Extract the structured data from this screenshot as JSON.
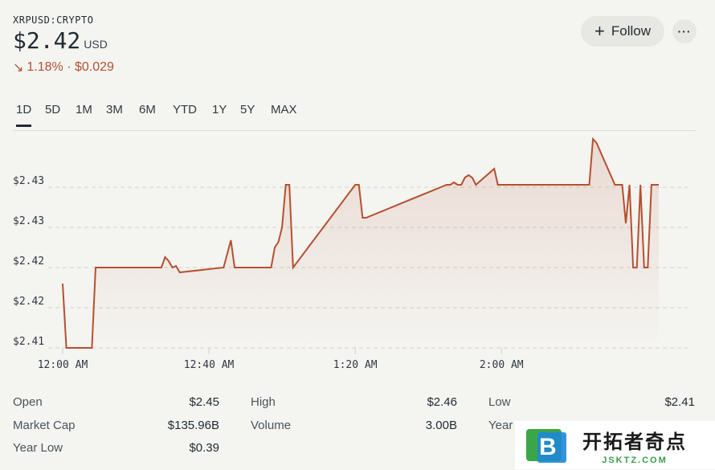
{
  "header": {
    "ticker": "XRPUSD:CRYPTO",
    "price": "$2.42",
    "currency": "USD",
    "change": "1.18% · $0.029",
    "change_color": "#b5502f"
  },
  "actions": {
    "follow_label": "Follow",
    "more_label": "···"
  },
  "tabs": [
    {
      "label": "1D",
      "active": true
    },
    {
      "label": "5D"
    },
    {
      "label": "1M"
    },
    {
      "label": "3M"
    },
    {
      "label": "6M"
    },
    {
      "label": "YTD"
    },
    {
      "label": "1Y"
    },
    {
      "label": "5Y"
    },
    {
      "label": "MAX"
    }
  ],
  "chart_data": {
    "type": "line",
    "y_tick_labels": [
      "$2.43",
      "$2.43",
      "$2.42",
      "$2.42",
      "$2.41"
    ],
    "x_tick_labels": [
      "12:00 AM",
      "12:40 AM",
      "1:20 AM",
      "2:00 AM"
    ],
    "line_color": "#b5502f",
    "grid": "dashed horizontal",
    "ylim": [
      2.41,
      2.43
    ],
    "series": [
      {
        "values_time_minutes": [
          0,
          1,
          8,
          9,
          27,
          28,
          29,
          30,
          31,
          32,
          44,
          46,
          47,
          57,
          58,
          59,
          60,
          61,
          62,
          63,
          80,
          81,
          82,
          83,
          105,
          106,
          107,
          108,
          109,
          110,
          111,
          112,
          113,
          118,
          119,
          120,
          121,
          144,
          145,
          146,
          151,
          152,
          153,
          154,
          155,
          156,
          157,
          158,
          159,
          160,
          161,
          162,
          163
        ],
        "values": [
          2.418,
          2.41,
          2.41,
          2.42,
          2.42,
          2.4213,
          2.4208,
          2.42,
          2.4202,
          2.4194,
          2.42,
          2.4234,
          2.42,
          2.42,
          2.4225,
          2.4232,
          2.425,
          2.4303,
          2.4303,
          2.42,
          2.4303,
          2.4303,
          2.4262,
          2.4262,
          2.4303,
          2.4303,
          2.4306,
          2.4303,
          2.4303,
          2.4312,
          2.4315,
          2.4312,
          2.4303,
          2.4323,
          2.4303,
          2.4303,
          2.4303,
          2.4303,
          2.436,
          2.4355,
          2.4303,
          2.4303,
          2.4303,
          2.4255,
          2.4303,
          2.42,
          2.42,
          2.4303,
          2.42,
          2.42,
          2.4303,
          2.4303,
          2.4303
        ]
      }
    ]
  },
  "stats": [
    [
      {
        "label": "Open",
        "value": "$2.45"
      },
      {
        "label": "High",
        "value": "$2.46"
      },
      {
        "label": "Low",
        "value": "$2.41"
      }
    ],
    [
      {
        "label": "Market Cap",
        "value": "$135.96B"
      },
      {
        "label": "Volume",
        "value": "3.00B"
      },
      {
        "label": "Year",
        "value": ""
      }
    ],
    [
      {
        "label": "Year Low",
        "value": "$0.39"
      }
    ]
  ],
  "watermark": {
    "title": "开拓者奇点",
    "subtitle": "JSKTZ.COM",
    "logo_letter": "B"
  }
}
